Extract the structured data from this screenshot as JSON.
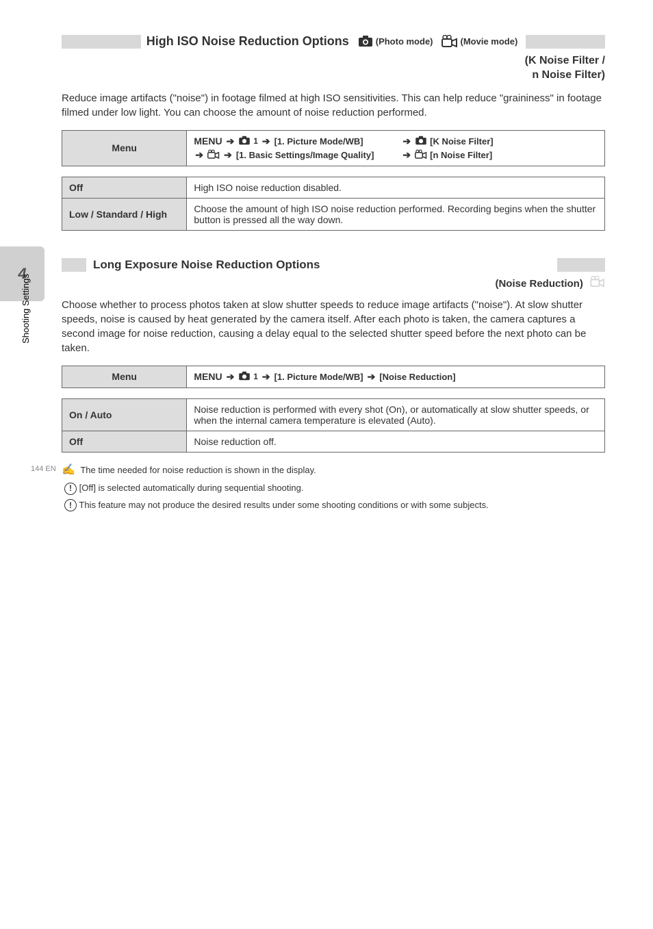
{
  "sidebar": {
    "tab_number": "4",
    "vertical_label": "Shooting Settings"
  },
  "page_number": "144   EN",
  "section1": {
    "header_title": "High ISO Noise Reduction Options",
    "mode_photo": "(Photo mode)",
    "mode_video": "(Movie mode)",
    "title_line1": "(K Noise Filter /",
    "title_line2": "n Noise Filter)",
    "paragraph": "Reduce image artifacts (\"noise\") in footage filmed at high ISO sensitivities. This can help reduce \"graininess\" in footage filmed under low light. You can choose the amount of noise reduction performed.",
    "menu_header": "Menu",
    "menu_path_photo_a": "[1. Picture Mode/WB]",
    "menu_path_photo_b": "[K Noise Filter]",
    "menu_path_video_a": "[1. Basic Settings/Image Quality]",
    "menu_path_video_b": "[n Noise Filter]",
    "row_off": {
      "label": "Off",
      "desc": "High ISO noise reduction disabled."
    },
    "row_levels": {
      "label": "Low / Standard / High",
      "desc": "Choose the amount of high ISO noise reduction performed. Recording begins when the shutter button is pressed all the way down."
    }
  },
  "section2": {
    "header_title": "Long Exposure Noise Reduction Options",
    "title_right": "(Noise Reduction)",
    "paragraph": "Choose whether to process photos taken at slow shutter speeds to reduce image artifacts (\"noise\"). At slow shutter speeds, noise is caused by heat generated by the camera itself. After each photo is taken, the camera captures a second image for noise reduction, causing a delay equal to the selected shutter speed before the next photo can be taken.",
    "menu_header": "Menu",
    "menu_path_a": "[1. Picture Mode/WB]",
    "menu_path_b": "[Noise Reduction]",
    "row_on_auto": {
      "label": "On / Auto",
      "desc": "Noise reduction is performed with every shot (On), or automatically at slow shutter speeds, or when the internal camera temperature is elevated (Auto)."
    },
    "row_off": {
      "label": "Off",
      "desc": "Noise reduction off."
    },
    "footnote": "The time needed for noise reduction is shown in the display.",
    "bullet1": "[Off] is selected automatically during sequential shooting.",
    "bullet2": "This feature may not produce the desired results under some shooting conditions or with some subjects."
  }
}
